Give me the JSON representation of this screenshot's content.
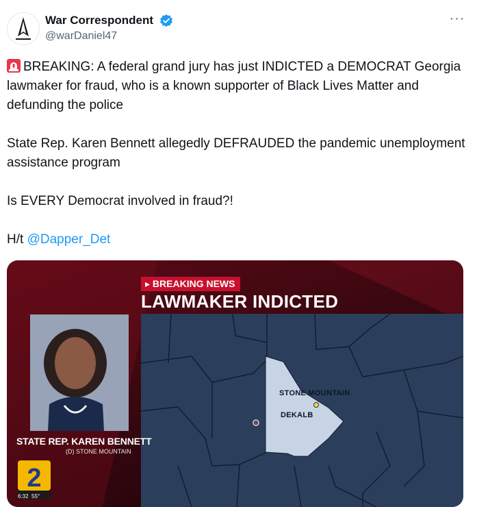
{
  "author": {
    "display_name": "War Correspondent",
    "handle": "@warDaniel47",
    "verified": true,
    "avatar_icon": "rocket-emblem-icon"
  },
  "more_icon": "more-options-icon",
  "tweet": {
    "paragraph1": "BREAKING: A federal grand jury has just INDICTED a DEMOCRAT Georgia lawmaker for fraud, who is a known supporter of Black Lives Matter and defunding the police",
    "paragraph2": "State Rep. Karen Bennett allegedly DEFRAUDED the pandemic unemployment assistance program",
    "paragraph3": "Is EVERY Democrat involved in fraud?!",
    "ht_prefix": "H/t ",
    "mention": "@Dapper_Det",
    "siren_icon": "police-siren-icon"
  },
  "media": {
    "breaking_tag": "BREAKING NEWS",
    "headline": "LAWMAKER INDICTED",
    "lower_third_name": "STATE REP. KAREN BENNETT",
    "lower_third_sub": "(D) STONE MOUNTAIN",
    "map_label_city": "STONE MOUNTAIN",
    "map_label_county": "DEKALB",
    "channel_number": "2",
    "time": "6:32",
    "temperature": "55°"
  },
  "colors": {
    "verified_blue": "#1d9bf0",
    "breaking_red": "#c8102e",
    "map_base": "#2b3f5c",
    "map_highlight": "#c7d4e6",
    "channel_yellow": "#f5b800"
  }
}
